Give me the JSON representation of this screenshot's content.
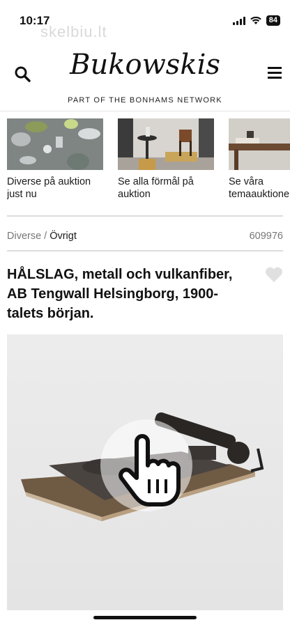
{
  "status_bar": {
    "time": "10:17",
    "watermark": "skelbiu.lt",
    "battery": "84"
  },
  "header": {
    "logo": "Bukowskis",
    "tagline": "PART OF THE BONHAMS NETWORK",
    "search_icon": "search-icon",
    "menu_icon": "hamburger-menu-icon"
  },
  "categories": [
    {
      "label": "Diverse på auktion just nu"
    },
    {
      "label": "Se alla förmål på auktion"
    },
    {
      "label": "Se våra temaauktioner"
    }
  ],
  "breadcrumb": {
    "parent": "Diverse",
    "separator": "/",
    "current": "Övrigt"
  },
  "lot_number": "609976",
  "product": {
    "title": "HÅLSLAG, metall och vulkanfiber, AB Tengwall Helsingborg, 1900-talets början.",
    "favorite_icon": "heart-icon",
    "overlay_icon": "tap-hand-icon"
  }
}
